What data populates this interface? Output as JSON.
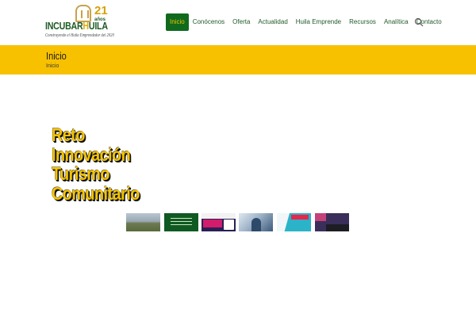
{
  "header": {
    "logo": {
      "word_left": "INCUBAR",
      "word_h": "H",
      "word_right": "UILA",
      "badge_number": "21",
      "badge_text": "años",
      "tagline": "Construyendo el Huila Emprendedor del 2020"
    },
    "nav": [
      {
        "label": "Inicio",
        "active": true
      },
      {
        "label": "Conócenos",
        "active": false
      },
      {
        "label": "Oferta",
        "active": false
      },
      {
        "label": "Actualidad",
        "active": false
      },
      {
        "label": "Huila Emprende",
        "active": false
      },
      {
        "label": "Recursos",
        "active": false
      },
      {
        "label": "Analítica",
        "active": false
      },
      {
        "label": "Contacto",
        "active": false
      }
    ],
    "search_icon": "search-icon"
  },
  "page_bar": {
    "title": "Inicio",
    "breadcrumb": "Inicio"
  },
  "hero": {
    "lines": [
      "Reto",
      "Innovación",
      "Turismo",
      "Comunitario"
    ]
  },
  "thumbnails": [
    {
      "name": "thumbnail-landscape"
    },
    {
      "name": "thumbnail-green-announcement"
    },
    {
      "name": "thumbnail-purple-flyer"
    },
    {
      "name": "thumbnail-person-tech"
    },
    {
      "name": "thumbnail-convocatoria"
    },
    {
      "name": "thumbnail-dark-banner"
    }
  ],
  "colors": {
    "brand_green": "#0f6a1e",
    "brand_yellow": "#f7c100",
    "nav_text": "#1f5a26"
  }
}
